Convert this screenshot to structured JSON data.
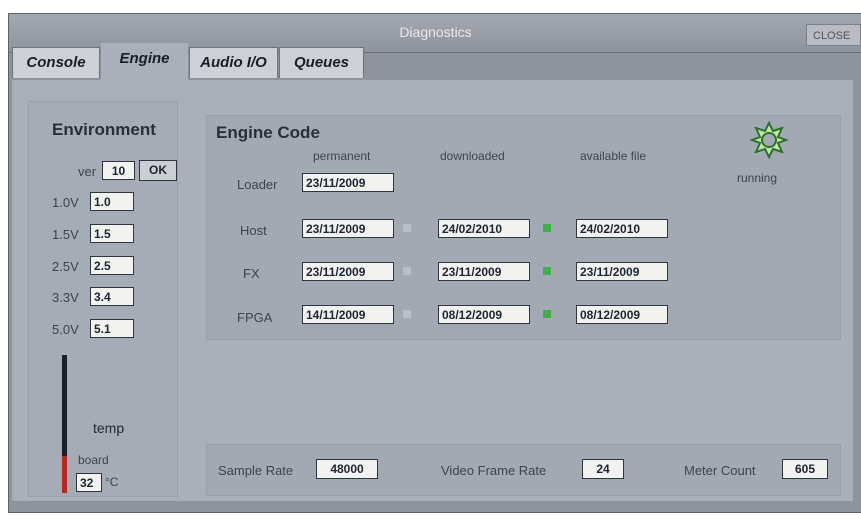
{
  "window": {
    "title": "Diagnostics",
    "close_label": "CLOSE"
  },
  "tabs": [
    {
      "label": "Console",
      "active": false
    },
    {
      "label": "Engine",
      "active": true
    },
    {
      "label": "Audio I/O",
      "active": false
    },
    {
      "label": "Queues",
      "active": false
    }
  ],
  "environment": {
    "heading": "Environment",
    "ver_label": "ver",
    "ver_value": "10",
    "ver_status": "OK",
    "voltages": [
      {
        "label": "1.0V",
        "value": "1.0"
      },
      {
        "label": "1.5V",
        "value": "1.5"
      },
      {
        "label": "2.5V",
        "value": "2.5"
      },
      {
        "label": "3.3V",
        "value": "3.4"
      },
      {
        "label": "5.0V",
        "value": "5.1"
      }
    ],
    "temp_label": "temp",
    "board_label": "board",
    "board_temp": "32",
    "temp_unit": "°C",
    "temp_level_fraction": 0.27,
    "temp_fill_color": "#b52624"
  },
  "engine_code": {
    "heading": "Engine Code",
    "columns": {
      "permanent": "permanent",
      "downloaded": "downloaded",
      "available": "available file"
    },
    "status_icon": "running-spinner-icon",
    "status_label": "running",
    "status_color": "#3a7a3a",
    "rows": [
      {
        "label": "Loader",
        "permanent": "23/11/2009",
        "downloaded": "",
        "available": ""
      },
      {
        "label": "Host",
        "permanent": "23/11/2009",
        "downloaded": "24/02/2010",
        "available": "24/02/2010"
      },
      {
        "label": "FX",
        "permanent": "23/11/2009",
        "downloaded": "23/11/2009",
        "available": "23/11/2009"
      },
      {
        "label": "FPGA",
        "permanent": "14/11/2009",
        "downloaded": "08/12/2009",
        "available": "08/12/2009"
      }
    ],
    "match_indicator_color": "#3fb247"
  },
  "footer": {
    "sample_rate_label": "Sample Rate",
    "sample_rate_value": "48000",
    "video_frame_rate_label": "Video Frame Rate",
    "video_frame_rate_value": "24",
    "meter_count_label": "Meter Count",
    "meter_count_value": "605"
  }
}
